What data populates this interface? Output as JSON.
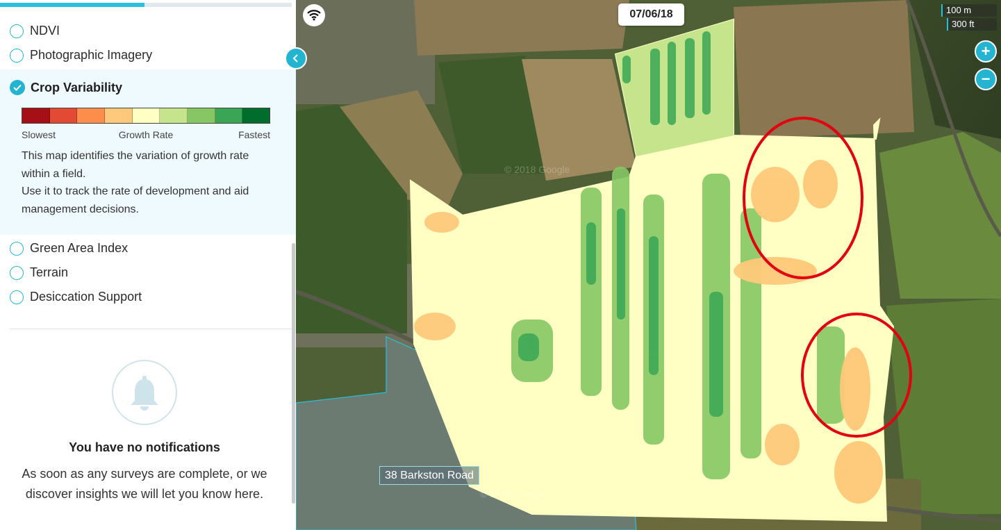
{
  "sidebar": {
    "progress": 0.495,
    "layers_top": [
      {
        "label": "NDVI"
      },
      {
        "label": "Photographic Imagery"
      }
    ],
    "selected_layer": {
      "label": "Crop Variability",
      "legend": {
        "colors": [
          "#a50f15",
          "#e34a33",
          "#fc8d4a",
          "#fec97a",
          "#ffffc4",
          "#c6e48b",
          "#86c764",
          "#3aa655",
          "#006d2c"
        ],
        "left_label": "Slowest",
        "center_label": "Growth Rate",
        "right_label": "Fastest"
      },
      "description_1": "This map identifies the variation of growth rate within a field.",
      "description_2": "Use it to track the rate of development and aid management decisions."
    },
    "layers_bottom": [
      {
        "label": "Green Area Index"
      },
      {
        "label": "Terrain"
      },
      {
        "label": "Desiccation Support"
      }
    ],
    "notifications": {
      "icon": "bell-icon",
      "title": "You have no notifications",
      "body": "As soon as any surveys are complete, or we discover insights we will let you know here."
    }
  },
  "map": {
    "date": "07/06/18",
    "scale_metric": "100 m",
    "scale_imperial": "300 ft",
    "zoom_in": "+",
    "zoom_out": "−",
    "address_label": "38 Barkston Road",
    "watermark_1": "© 2018 Google",
    "watermark_2": "© 2018 Google",
    "highlight_color": "#e3000f",
    "field_boundary_color": "#28c0dc"
  }
}
